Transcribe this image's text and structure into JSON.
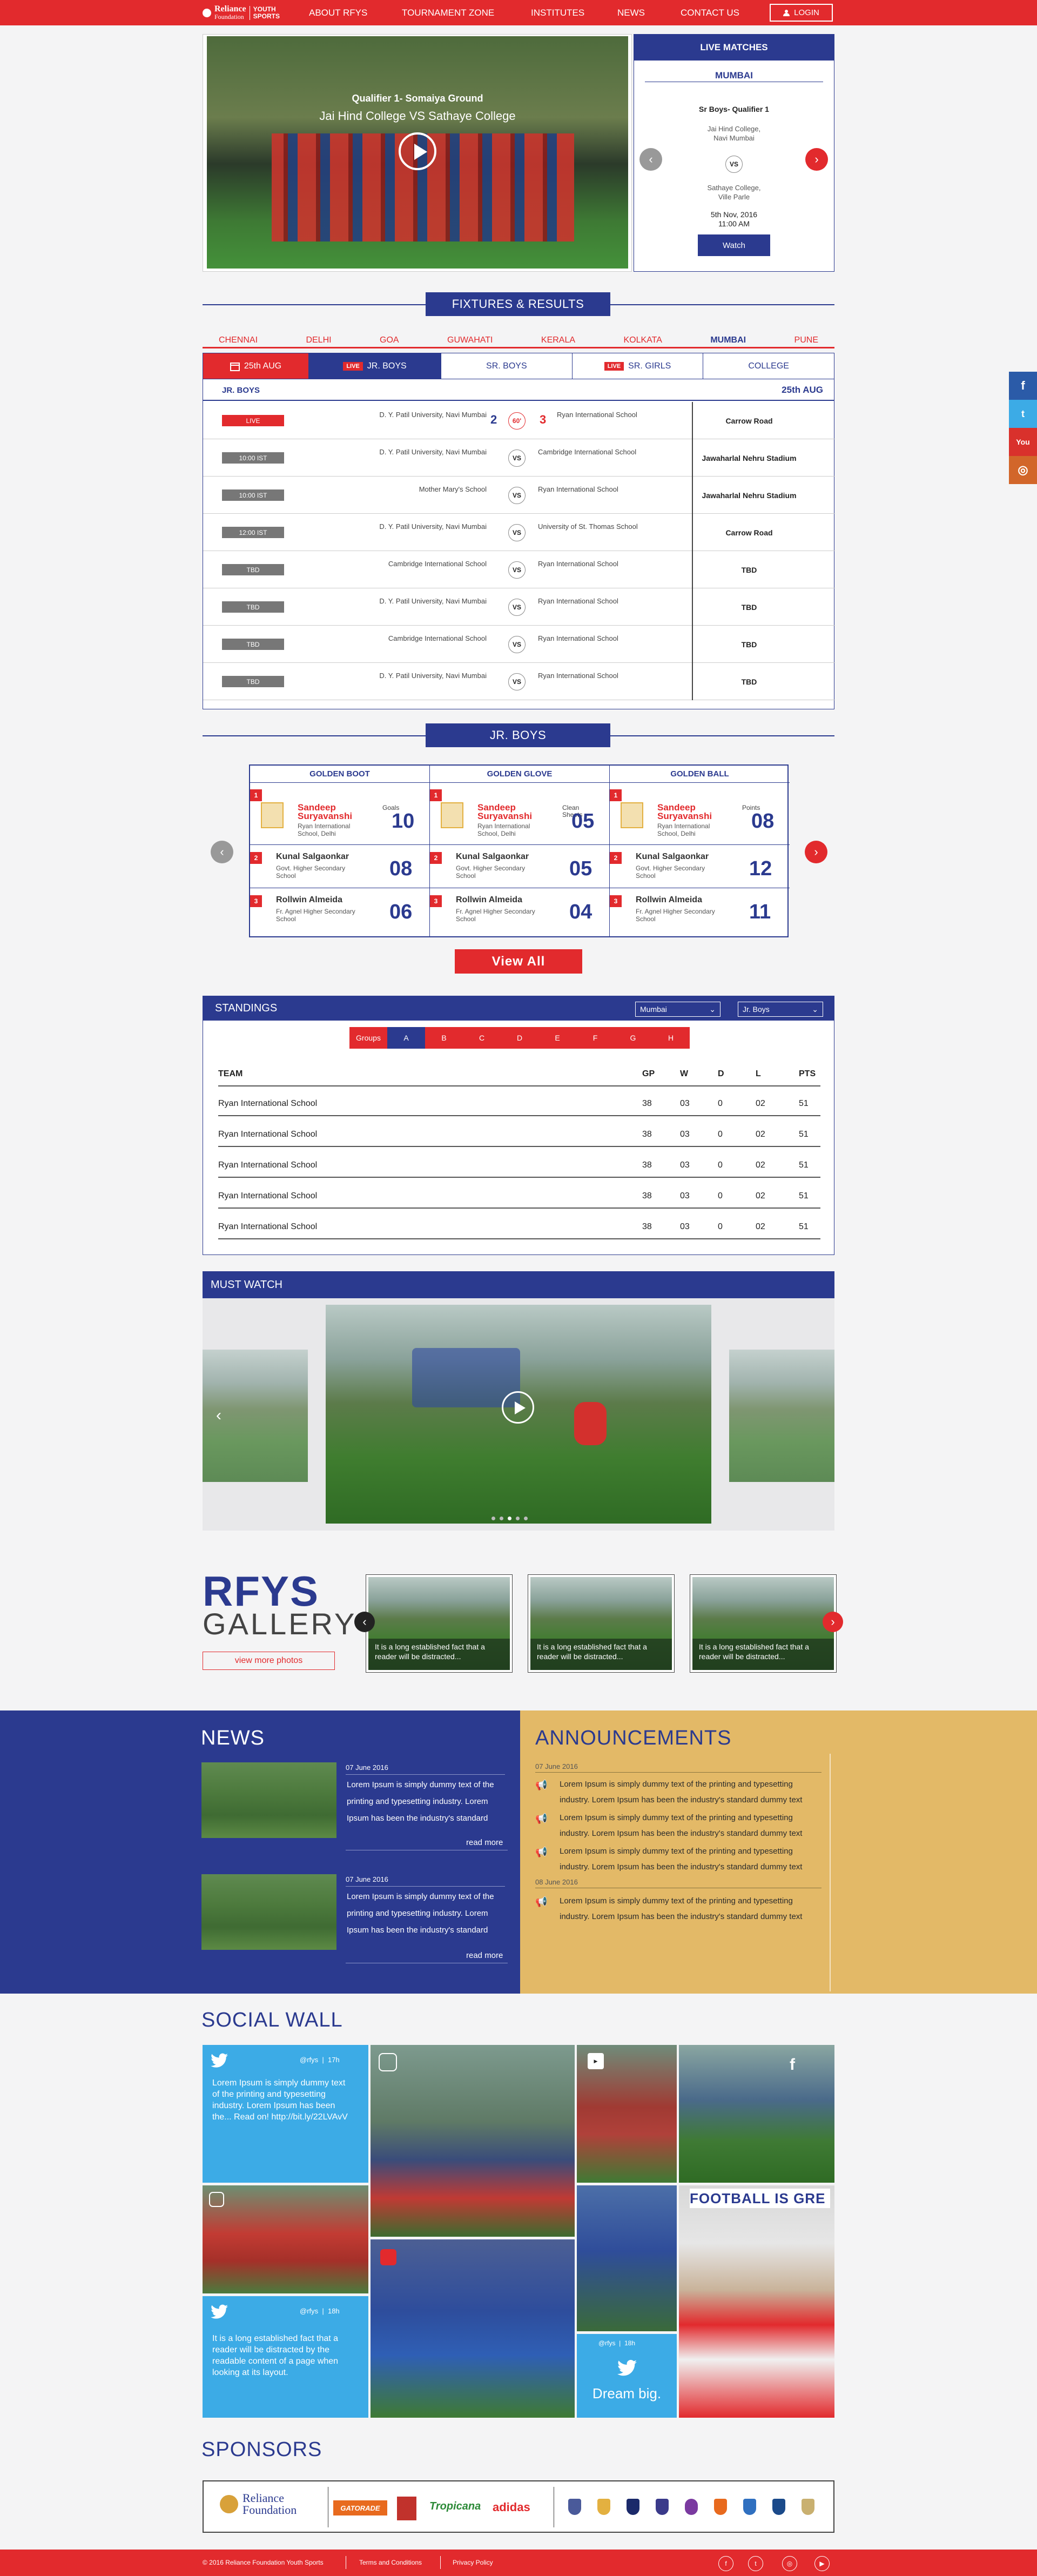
{
  "nav": {
    "brand_line1": "Reliance",
    "brand_line1b": "Foundation",
    "brand_line2a": "YOUTH",
    "brand_line2b": "SPORTS",
    "items": [
      "ABOUT RFYS",
      "TOURNAMENT ZONE",
      "INSTITUTES",
      "NEWS",
      "CONTACT US"
    ],
    "login": "LOGIN"
  },
  "hero": {
    "caption_small": "Qualifier 1- Somaiya Ground",
    "caption_large": "Jai Hind College VS Sathaye College"
  },
  "live": {
    "title": "LIVE MATCHES",
    "city": "MUMBAI",
    "stage": "Sr Boys- Qualifier 1",
    "team1_line1": "Jai Hind College,",
    "team1_line2": "Navi Mumbai",
    "vs": "VS",
    "team2_line1": "Sathaye College,",
    "team2_line2": "Ville Parle",
    "date": "5th Nov, 2016",
    "time": "11:00 AM",
    "watch": "Watch"
  },
  "fixtures": {
    "title": "FIXTURES & RESULTS",
    "cities": [
      "CHENNAI",
      "DELHI",
      "GOA",
      "GUWAHATI",
      "KERALA",
      "KOLKATA",
      "MUMBAI",
      "PUNE"
    ],
    "active_city": "MUMBAI",
    "date_tab": "25th AUG",
    "tabs": [
      {
        "label": "JR. BOYS",
        "live": "LIVE"
      },
      {
        "label": "SR. BOYS",
        "live": ""
      },
      {
        "label": "SR. GIRLS",
        "live": "LIVE"
      },
      {
        "label": "COLLEGE",
        "live": ""
      }
    ],
    "sub_left": "JR. BOYS",
    "sub_right": "25th AUG",
    "rows": [
      {
        "status": "LIVE",
        "team1": "D. Y. Patil University, Navi Mumbai",
        "s1": "2",
        "mid": "60'",
        "s2": "3",
        "team2": "Ryan International School",
        "venue": "Carrow Road"
      },
      {
        "status": "10:00 IST",
        "team1": "D. Y. Patil University, Navi Mumbai",
        "s1": "",
        "mid": "VS",
        "s2": "",
        "team2": "Cambridge International School",
        "venue": "Jawaharlal Nehru Stadium"
      },
      {
        "status": "10:00 IST",
        "team1": "Mother Mary's School",
        "s1": "",
        "mid": "VS",
        "s2": "",
        "team2": "Ryan International School",
        "venue": "Jawaharlal Nehru Stadium"
      },
      {
        "status": "12:00 IST",
        "team1": "D. Y. Patil University, Navi Mumbai",
        "s1": "",
        "mid": "VS",
        "s2": "",
        "team2": "University of St. Thomas School",
        "venue": "Carrow Road"
      },
      {
        "status": "TBD",
        "team1": "Cambridge International School",
        "s1": "",
        "mid": "VS",
        "s2": "",
        "team2": "Ryan International School",
        "venue": "TBD"
      },
      {
        "status": "TBD",
        "team1": "D. Y. Patil University, Navi Mumbai",
        "s1": "",
        "mid": "VS",
        "s2": "",
        "team2": "Ryan International School",
        "venue": "TBD"
      },
      {
        "status": "TBD",
        "team1": "Cambridge International School",
        "s1": "",
        "mid": "VS",
        "s2": "",
        "team2": "Ryan International School",
        "venue": "TBD"
      },
      {
        "status": "TBD",
        "team1": "D. Y. Patil University, Navi Mumbai",
        "s1": "",
        "mid": "VS",
        "s2": "",
        "team2": "Ryan International School",
        "venue": "TBD"
      }
    ]
  },
  "awards": {
    "title": "JR. BOYS",
    "columns": [
      {
        "head": "GOLDEN BOOT",
        "stat": "Goals",
        "top": {
          "first": "Sandeep",
          "last": "Suryavanshi",
          "school": "Ryan International School, Delhi",
          "value": "10"
        },
        "second": {
          "name": "Kunal Salgaonkar",
          "school": "Govt. Higher Secondary School",
          "value": "08"
        },
        "third": {
          "name": "Rollwin Almeida",
          "school": "Fr. Agnel Higher Secondary School",
          "value": "06"
        }
      },
      {
        "head": "GOLDEN GLOVE",
        "stat": "Clean Sheets",
        "top": {
          "first": "Sandeep",
          "last": "Suryavanshi",
          "school": "Ryan International School, Delhi",
          "value": "05"
        },
        "second": {
          "name": "Kunal Salgaonkar",
          "school": "Govt. Higher Secondary School",
          "value": "05"
        },
        "third": {
          "name": "Rollwin Almeida",
          "school": "Fr. Agnel Higher Secondary School",
          "value": "04"
        }
      },
      {
        "head": "GOLDEN BALL",
        "stat": "Points",
        "top": {
          "first": "Sandeep",
          "last": "Suryavanshi",
          "school": "Ryan International School, Delhi",
          "value": "08"
        },
        "second": {
          "name": "Kunal Salgaonkar",
          "school": "Govt. Higher Secondary School",
          "value": "12"
        },
        "third": {
          "name": "Rollwin Almeida",
          "school": "Fr. Agnel Higher Secondary School",
          "value": "11"
        }
      }
    ],
    "ranks": [
      "1",
      "2",
      "3"
    ],
    "view_all": "View All"
  },
  "standings": {
    "title": "STANDINGS",
    "city_select": "Mumbai",
    "cat_select": "Jr. Boys",
    "groups": [
      "Groups",
      "A",
      "B",
      "C",
      "D",
      "E",
      "F",
      "G",
      "H"
    ],
    "active_group": "A",
    "headers": [
      "TEAM",
      "GP",
      "W",
      "D",
      "L",
      "PTS"
    ],
    "rows": [
      [
        "Ryan International School",
        "38",
        "03",
        "0",
        "02",
        "51"
      ],
      [
        "Ryan International School",
        "38",
        "03",
        "0",
        "02",
        "51"
      ],
      [
        "Ryan International School",
        "38",
        "03",
        "0",
        "02",
        "51"
      ],
      [
        "Ryan International School",
        "38",
        "03",
        "0",
        "02",
        "51"
      ],
      [
        "Ryan International School",
        "38",
        "03",
        "0",
        "02",
        "51"
      ]
    ]
  },
  "must_watch": {
    "title": "MUST WATCH",
    "active_dot": 3
  },
  "gallery": {
    "word1": "RFYS",
    "word2": "GALLERY",
    "more": "view more photos",
    "caption": "It is a long established fact that a reader will be distracted..."
  },
  "news": {
    "title": "NEWS",
    "items": [
      {
        "date": "07 June 2016",
        "text": "Lorem Ipsum is simply dummy text of the printing and typesetting industry. Lorem Ipsum has been the industry's standard",
        "more": "read more"
      },
      {
        "date": "07 June 2016",
        "text": "Lorem Ipsum is simply dummy text of the printing and typesetting industry. Lorem Ipsum has been the industry's standard",
        "more": "read more"
      }
    ]
  },
  "announcements": {
    "title": "ANNOUNCEMENTS",
    "groups": [
      {
        "date": "07 June 2016",
        "items": [
          "Lorem Ipsum is simply dummy text of the printing and typesetting industry. Lorem Ipsum has been the industry's standard dummy text",
          "Lorem Ipsum is simply dummy text of the printing and typesetting industry. Lorem Ipsum has been the industry's standard dummy text",
          "Lorem Ipsum is simply dummy text of the printing and typesetting industry. Lorem Ipsum has been the industry's standard dummy text"
        ]
      },
      {
        "date": "08 June 2016",
        "items": [
          "Lorem Ipsum is simply dummy text of the printing and typesetting industry. Lorem Ipsum has been the industry's standard dummy text"
        ]
      }
    ]
  },
  "social": {
    "title": "SOCIAL WALL",
    "tweet1": {
      "handle": "@rfys",
      "age": "17h",
      "text": "Lorem Ipsum is simply dummy text of the printing and typesetting industry. Lorem Ipsum has been the... Read on! http://bit.ly/22LVAvV"
    },
    "tweet2": {
      "handle": "@rfys",
      "age": "18h",
      "text": "It is a long established fact that a reader will be distracted by the readable content of a page when looking at its layout."
    },
    "tweet3": {
      "handle": "@rfys",
      "age": "18h",
      "text": "Dream big."
    },
    "banner": "FOOTBALL IS GRE"
  },
  "sponsors": {
    "title": "SPONSORS",
    "main_line1": "Reliance",
    "main_line2": "Foundation",
    "others": [
      "GATORADE",
      "Tropicana",
      "adidas"
    ]
  },
  "footer": {
    "copyright": "© 2016 Reliance Foundation Youth Sports",
    "links": [
      "Terms and Conditions",
      "Privacy Policy"
    ]
  },
  "colors": {
    "red": "#e22a2d",
    "blue": "#2b3a8f",
    "gold": "#e3b967",
    "twitter": "#3cabe6"
  }
}
